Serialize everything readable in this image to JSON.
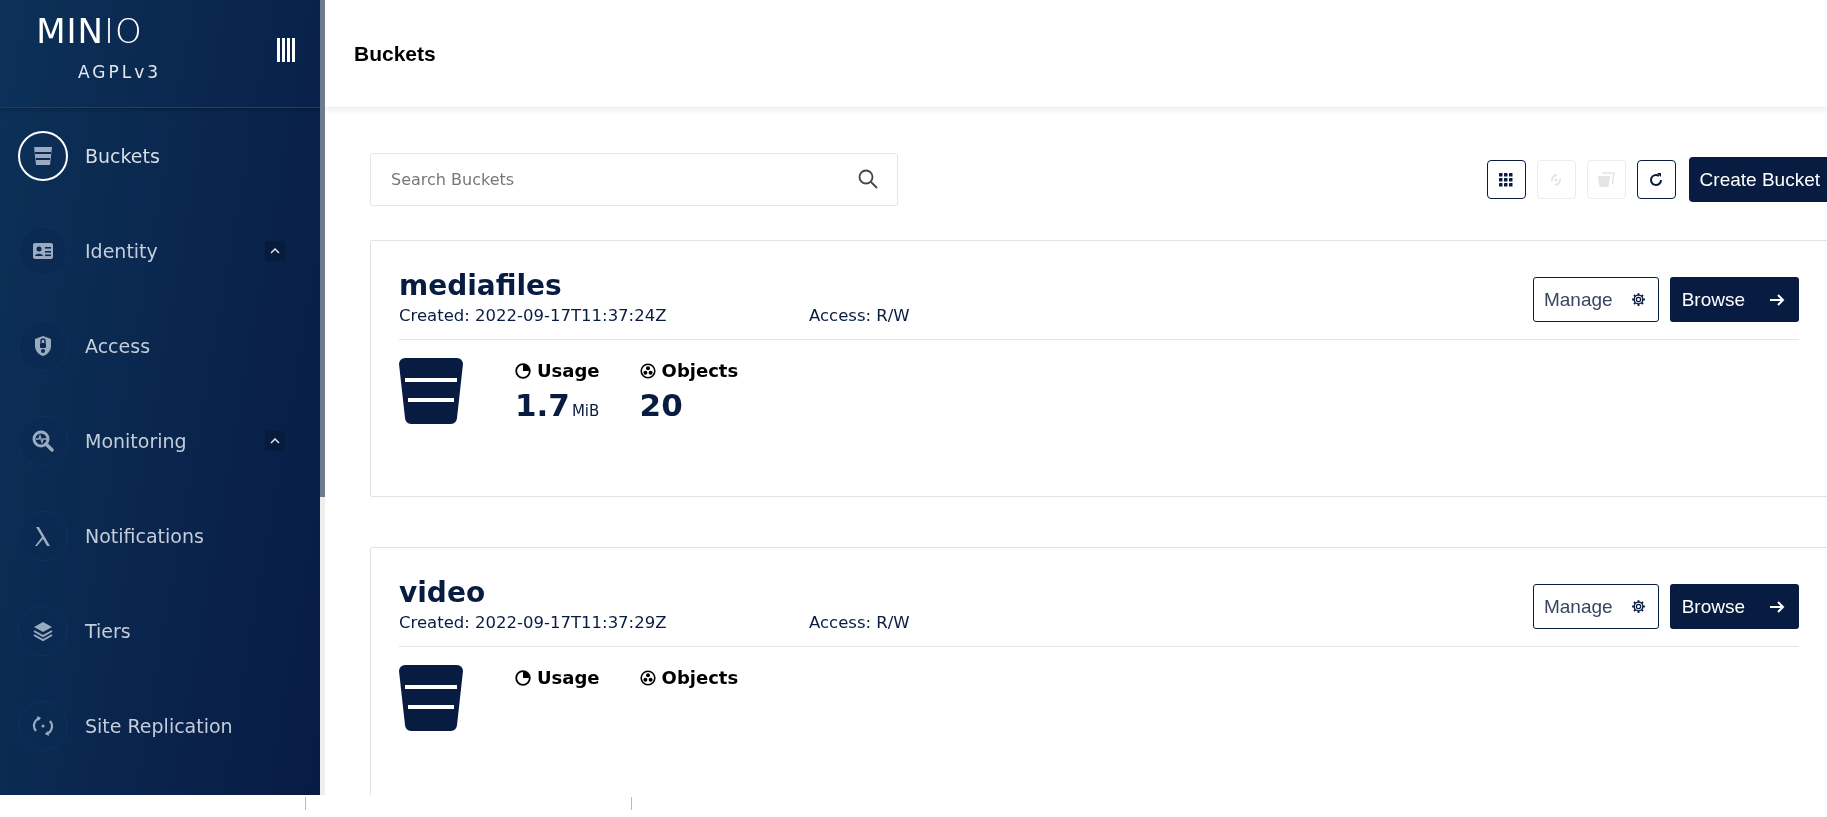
{
  "sidebar": {
    "logo": "**MIN**IO",
    "license": "AGPLv3",
    "items": [
      {
        "label": "Buckets",
        "selected": true,
        "kind": "link"
      },
      {
        "label": "Identity",
        "selected": false,
        "kind": "group"
      },
      {
        "label": "Access",
        "selected": false,
        "kind": "link"
      },
      {
        "label": "Monitoring",
        "selected": false,
        "kind": "group"
      },
      {
        "label": "Notifications",
        "selected": false,
        "kind": "link"
      },
      {
        "label": "Tiers",
        "selected": false,
        "kind": "link"
      },
      {
        "label": "Site Replication",
        "selected": false,
        "kind": "link"
      }
    ]
  },
  "header": {
    "title": "Buckets"
  },
  "search": {
    "placeholder": "Search Buckets"
  },
  "toolbar": [
    {
      "disabled": false
    },
    {
      "disabled": true
    },
    {
      "disabled": true
    },
    {
      "disabled": false
    }
  ],
  "create_button": "Create Bucket",
  "buckets": [
    {
      "name": "mediafiles",
      "created": "Created: 2022-09-17T11:37:24Z",
      "access": "Access: R/W",
      "manage": "Manage",
      "browse": "Browse",
      "usage_label": "Usage",
      "usage_value": "1.7",
      "usage_unit": "MiB",
      "objects_label": "Objects",
      "objects_value": "20"
    },
    {
      "name": "video",
      "created": "Created: 2022-09-17T11:37:29Z",
      "access": "Access: R/W",
      "manage": "Manage",
      "browse": "Browse",
      "usage_label": "Usage",
      "objects_label": "Objects"
    }
  ]
}
